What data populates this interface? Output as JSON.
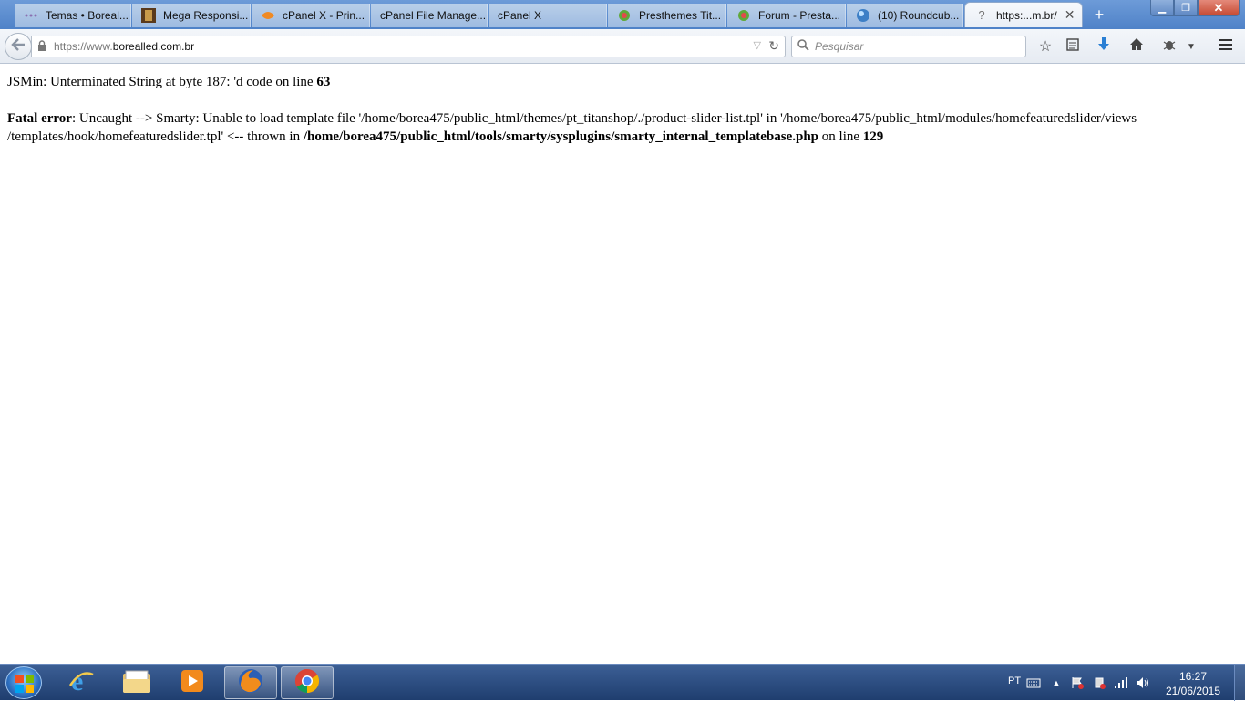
{
  "browser": {
    "tabs": [
      {
        "label": "Temas • Boreal...",
        "favicon": "dots-icon",
        "active": false
      },
      {
        "label": "Mega Responsi...",
        "favicon": "image-thumbnail-icon",
        "active": false
      },
      {
        "label": "cPanel X - Prin...",
        "favicon": "cpanel-icon",
        "active": false
      },
      {
        "label": "cPanel File Manage...",
        "favicon": "",
        "active": false
      },
      {
        "label": "cPanel X",
        "favicon": "",
        "active": false
      },
      {
        "label": "Presthemes Tit...",
        "favicon": "prestashop-icon",
        "active": false
      },
      {
        "label": "Forum - Presta...",
        "favicon": "prestashop-icon",
        "active": false
      },
      {
        "label": "(10) Roundcub...",
        "favicon": "roundcube-icon",
        "active": false
      },
      {
        "label": "https:...m.br/",
        "favicon": "question-icon",
        "active": true
      }
    ],
    "new_tab_symbol": "+",
    "url": {
      "scheme": "https://www.",
      "host": "borealled.com.br"
    },
    "search_placeholder": "Pesquisar"
  },
  "page": {
    "line1": {
      "text": "JSMin: Unterminated String at byte 187: 'd code on line ",
      "bold": "63"
    },
    "line2": {
      "label": "Fatal error",
      "text": ": Uncaught --> Smarty: Unable to load template file '/home/borea475/public_html/themes/pt_titanshop/./product-slider-list.tpl' in '/home/borea475/public_html/modules/homefeaturedslider/views /templates/hook/homefeaturedslider.tpl' <-- thrown in ",
      "path": "/home/borea475/public_html/tools/smarty/sysplugins/smarty_internal_templatebase.php",
      "mid": " on line ",
      "line": "129"
    }
  },
  "taskbar": {
    "apps": [
      {
        "name": "internet-explorer-icon",
        "running": false
      },
      {
        "name": "windows-explorer-icon",
        "running": false
      },
      {
        "name": "media-player-icon",
        "running": false
      },
      {
        "name": "firefox-icon",
        "running": true
      },
      {
        "name": "chrome-icon",
        "running": true
      }
    ],
    "language": "PT",
    "time": "16:27",
    "date": "21/06/2015"
  },
  "colors": {
    "tabstrip": "#5a8bd0",
    "taskbar": "#1f3e6f",
    "download_arrow": "#2a7fd4"
  }
}
